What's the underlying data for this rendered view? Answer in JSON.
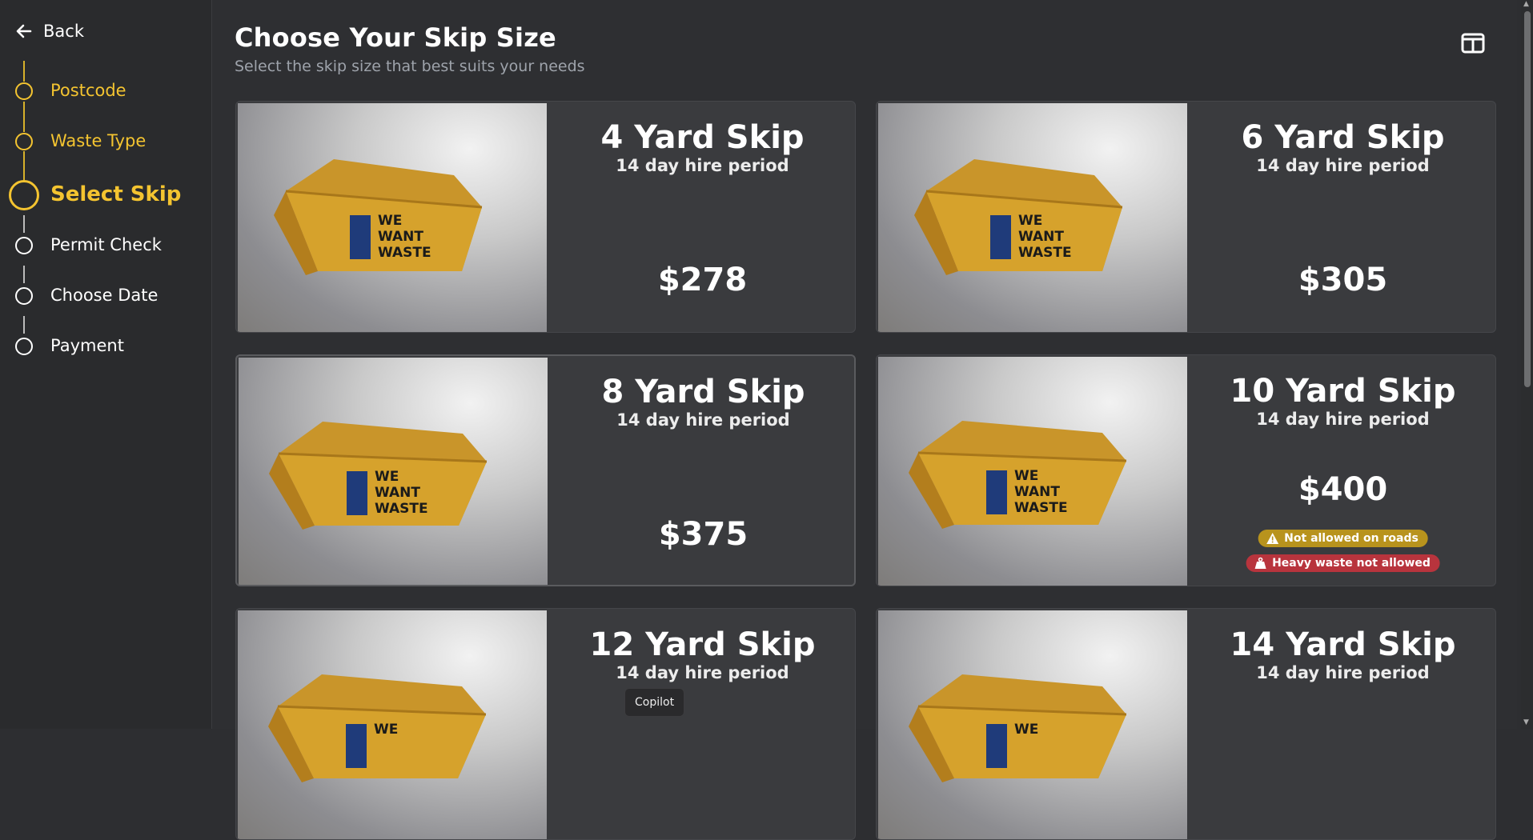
{
  "nav": {
    "back_label": "Back"
  },
  "steps": [
    {
      "label": "Postcode",
      "state": "done"
    },
    {
      "label": "Waste Type",
      "state": "done"
    },
    {
      "label": "Select Skip",
      "state": "current"
    },
    {
      "label": "Permit Check",
      "state": "todo"
    },
    {
      "label": "Choose Date",
      "state": "todo"
    },
    {
      "label": "Payment",
      "state": "todo"
    }
  ],
  "header": {
    "title": "Choose Your Skip Size",
    "subtitle": "Select the skip size that best suits your needs"
  },
  "skip_logo": [
    "WE",
    "WANT",
    "WASTE"
  ],
  "skips": [
    {
      "name": "4 Yard Skip",
      "hire": "14 day hire period",
      "price": "$278",
      "badges": []
    },
    {
      "name": "6 Yard Skip",
      "hire": "14 day hire period",
      "price": "$305",
      "badges": []
    },
    {
      "name": "8 Yard Skip",
      "hire": "14 day hire period",
      "price": "$375",
      "badges": []
    },
    {
      "name": "10 Yard Skip",
      "hire": "14 day hire period",
      "price": "$400",
      "badges": [
        {
          "type": "warning",
          "text": "Not allowed on roads"
        },
        {
          "type": "error",
          "text": "Heavy waste not allowed"
        }
      ]
    },
    {
      "name": "12 Yard Skip",
      "hire": "14 day hire period",
      "price": "",
      "badges": []
    },
    {
      "name": "14 Yard Skip",
      "hire": "14 day hire period",
      "price": "",
      "badges": []
    }
  ],
  "tooltip": "Copilot",
  "colors": {
    "accent": "#f4c430",
    "warning": "#b8931d",
    "error": "#b8343d"
  }
}
